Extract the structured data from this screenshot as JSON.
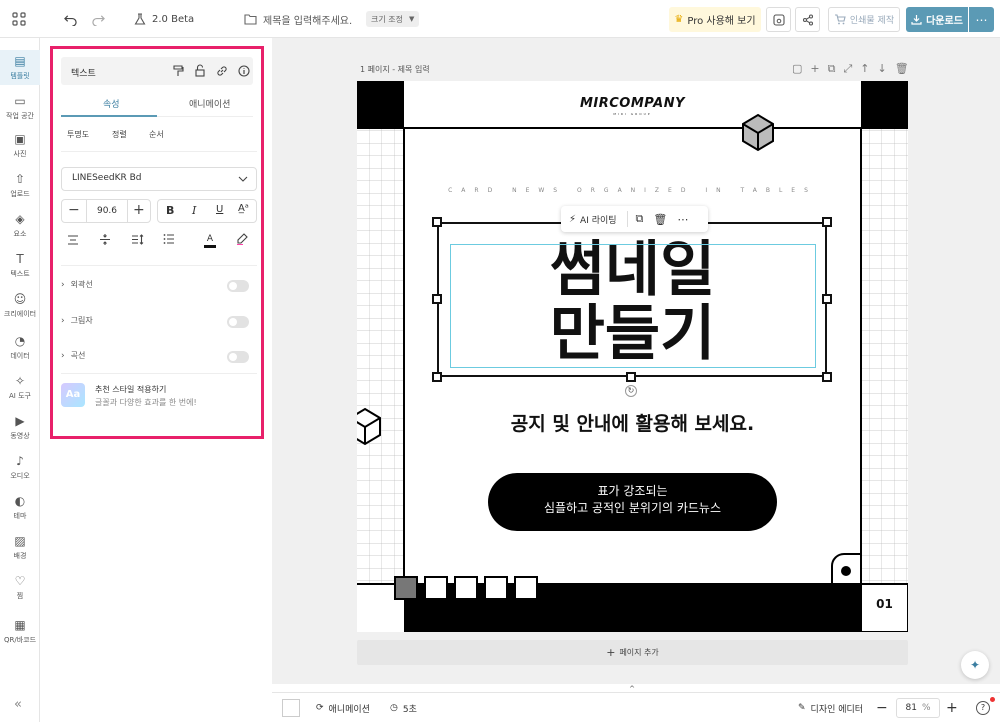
{
  "topbar": {
    "version": "2.0 Beta",
    "title_placeholder": "제목을 입력해주세요.",
    "resize_label": "크기 조정",
    "pro_label": "Pro 사용해 보기",
    "print_label": "인쇄물 제작",
    "download_label": "다운로드"
  },
  "leftnav": {
    "items": [
      {
        "label": "템플릿",
        "icon": "template-icon"
      },
      {
        "label": "작업 공간",
        "icon": "workspace-icon"
      },
      {
        "label": "사진",
        "icon": "photo-icon"
      },
      {
        "label": "업로드",
        "icon": "upload-icon"
      },
      {
        "label": "요소",
        "icon": "elements-icon"
      },
      {
        "label": "텍스트",
        "icon": "text-icon"
      },
      {
        "label": "크리에이터",
        "icon": "creator-icon"
      },
      {
        "label": "데이터",
        "icon": "data-icon"
      },
      {
        "label": "AI 도구",
        "icon": "ai-tools-icon"
      },
      {
        "label": "동영상",
        "icon": "video-icon"
      },
      {
        "label": "오디오",
        "icon": "audio-icon"
      },
      {
        "label": "테마",
        "icon": "theme-icon"
      },
      {
        "label": "배경",
        "icon": "background-icon"
      },
      {
        "label": "찜",
        "icon": "heart-icon"
      },
      {
        "label": "QR/바코드",
        "icon": "qr-icon"
      }
    ]
  },
  "panel": {
    "header_title": "텍스트",
    "tabs": [
      "속성",
      "애니메이션"
    ],
    "subtabs": [
      "투명도",
      "정렬",
      "순서"
    ],
    "font_name": "LINESeedKR Bd",
    "font_size": "90.6",
    "sections": [
      "외곽선",
      "그림자",
      "곡선"
    ],
    "recommend_title": "추천 스타일 적용하기",
    "recommend_desc": "글꼴과 다양한 효과를 한 번에!",
    "recommend_thumb": "Aa"
  },
  "canvas": {
    "page_label": "1 페이지 - 제목 입력",
    "logo_main": "MIRCOMPANY",
    "logo_sub": "MIRI GROUP",
    "tagline": "CARD NEWS ORGANIZED IN TABLES",
    "headline_1": "썸네일",
    "headline_2": "만들기",
    "subtitle": "공지 및 안내에 활용해 보세요.",
    "pill_line1": "표가 강조되는",
    "pill_line2": "심플하고 공적인 분위기의 카드뉴스",
    "page_number": "01",
    "toolbar_ai": "AI 라이팅",
    "add_page": "페이지 추가"
  },
  "bottombar": {
    "animation": "애니메이션",
    "duration": "5초",
    "design_editor": "디자인 에디터",
    "zoom": "81",
    "zoom_unit": "%"
  },
  "colors": {
    "accent": "#5b9ab5",
    "highlight": "#e8206a"
  }
}
